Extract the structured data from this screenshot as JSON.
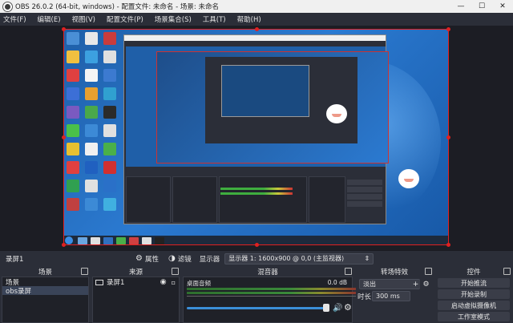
{
  "window": {
    "title": "OBS 26.0.2 (64-bit, windows) - 配置文件: 未命名 - 场景: 未命名",
    "minimize_glyph": "—",
    "maximize_glyph": "☐",
    "close_glyph": "✕"
  },
  "menu": {
    "items": [
      "文件(F)",
      "编辑(E)",
      "视图(V)",
      "配置文件(P)",
      "场景集合(S)",
      "工具(T)",
      "帮助(H)"
    ]
  },
  "scene_bar": {
    "scene_name": "录屏1",
    "properties_label": "属性",
    "filters_label": "滤镜",
    "display_label": "显示器",
    "display_value": "显示器 1: 1600x900 @ 0,0 (主监视器)"
  },
  "docks": {
    "scenes": {
      "title": "场景",
      "items": [
        "场景",
        "obs录屏"
      ],
      "selected_index": 1
    },
    "sources": {
      "title": "来源",
      "items": [
        "录屏1"
      ]
    },
    "mixer": {
      "title": "混音器",
      "track_name": "桌面音频",
      "db_value": "0.0 dB",
      "volume_fraction": 0.82
    },
    "transitions": {
      "title": "转场特效",
      "selected": "淡出",
      "duration_label": "时长",
      "duration_value": "300 ms"
    },
    "controls": {
      "title": "控件",
      "buttons": [
        "开始推流",
        "开始录制",
        "启动虚拟摄像机",
        "工作室模式"
      ]
    }
  },
  "colors": {
    "selection": "#e02020",
    "accent": "#3b8fd9",
    "panel_bg": "#2b2e38"
  }
}
